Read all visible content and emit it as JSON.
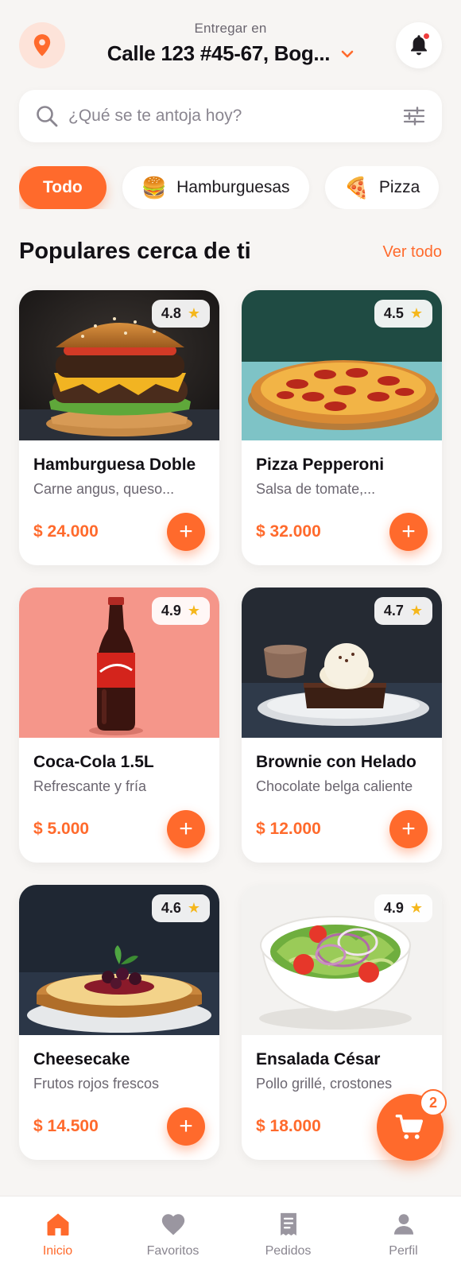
{
  "header": {
    "deliver_label": "Entregar en",
    "address": "Calle 123 #45-67, Bog...",
    "has_notification": true
  },
  "search": {
    "placeholder": "¿Qué se te antoja hoy?"
  },
  "categories": [
    {
      "label": "Todo",
      "emoji": "",
      "active": true
    },
    {
      "label": "Hamburguesas",
      "emoji": "🍔",
      "active": false
    },
    {
      "label": "Pizza",
      "emoji": "🍕",
      "active": false
    }
  ],
  "section": {
    "title": "Populares cerca de ti",
    "see_all": "Ver todo"
  },
  "products": [
    {
      "name": "Hamburguesa Doble",
      "desc": "Carne angus, queso...",
      "price": "$ 24.000",
      "rating": "4.8",
      "image": "burger"
    },
    {
      "name": "Pizza Pepperoni",
      "desc": "Salsa de tomate,...",
      "price": "$ 32.000",
      "rating": "4.5",
      "image": "pizza"
    },
    {
      "name": "Coca-Cola 1.5L",
      "desc": "Refrescante y fría",
      "price": "$ 5.000",
      "rating": "4.9",
      "image": "cola"
    },
    {
      "name": "Brownie con Helado",
      "desc": "Chocolate belga caliente",
      "price": "$ 12.000",
      "rating": "4.7",
      "image": "brownie"
    },
    {
      "name": "Cheesecake",
      "desc": "Frutos rojos frescos",
      "price": "$ 14.500",
      "rating": "4.6",
      "image": "cheesecake"
    },
    {
      "name": "Ensalada César",
      "desc": "Pollo grillé, crostones",
      "price": "$ 18.000",
      "rating": "4.9",
      "image": "salad"
    }
  ],
  "cart": {
    "count": "2"
  },
  "nav": [
    {
      "label": "Inicio",
      "icon": "home-icon",
      "active": true
    },
    {
      "label": "Favoritos",
      "icon": "heart-icon",
      "active": false
    },
    {
      "label": "Pedidos",
      "icon": "receipt-icon",
      "active": false
    },
    {
      "label": "Perfil",
      "icon": "person-icon",
      "active": false
    }
  ],
  "colors": {
    "accent": "#ff6a2c",
    "background": "#f7f5f3",
    "star": "#f5b71c"
  }
}
